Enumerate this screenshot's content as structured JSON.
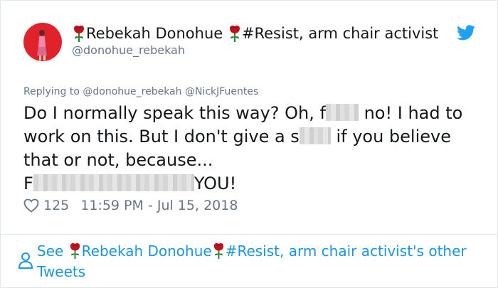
{
  "author": {
    "display_name_prefix_icon": "rose-icon",
    "display_name": "Rebekah Donohue",
    "display_name_suffix": "#Resist, arm chair activist",
    "handle": "@donohue_rebekah"
  },
  "reply": {
    "label": "Replying to @donohue_rebekah @NickJFuentes"
  },
  "tweet": {
    "line1_a": "Do I normally speak this way? Oh, f",
    "line1_b": " no! I had to",
    "line2_a": "work on this. But I don't give a s",
    "line2_b": " if you believe",
    "line3": "that or not, because...",
    "line4_a": "F",
    "line4_b": "YOU!"
  },
  "meta": {
    "likes": "125",
    "timestamp": "11:59 PM - Jul 15, 2018"
  },
  "footer": {
    "see_label": "See",
    "name": "Rebekah Donohue",
    "suffix": "#Resist, arm chair activist's other",
    "tweets_label": "Tweets"
  },
  "colors": {
    "link": "#1b95e0",
    "muted": "#657786",
    "rose": "#c0111f",
    "avatar_bg": "#e0232a"
  }
}
